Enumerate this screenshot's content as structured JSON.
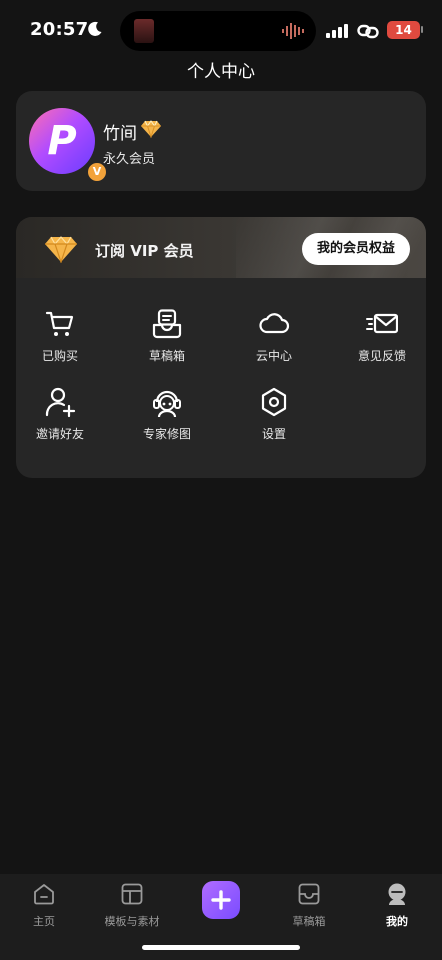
{
  "status_bar": {
    "time": "20:57",
    "battery": "14"
  },
  "header": {
    "title": "个人中心"
  },
  "profile": {
    "avatar_letter": "P",
    "badge_letter": "V",
    "username": "竹间",
    "member_type": "永久会员"
  },
  "vip": {
    "label": "订阅 VIP 会员",
    "button_label": "我的会员权益"
  },
  "menu": {
    "items": [
      {
        "label": "已购买",
        "icon": "cart-icon"
      },
      {
        "label": "草稿箱",
        "icon": "drafts-icon"
      },
      {
        "label": "云中心",
        "icon": "cloud-icon"
      },
      {
        "label": "意见反馈",
        "icon": "feedback-mail-icon"
      },
      {
        "label": "邀请好友",
        "icon": "add-user-icon"
      },
      {
        "label": "专家修图",
        "icon": "expert-icon"
      },
      {
        "label": "设置",
        "icon": "settings-icon"
      }
    ]
  },
  "tabbar": {
    "items": [
      {
        "label": "主页",
        "icon": "home-icon"
      },
      {
        "label": "模板与素材",
        "icon": "template-icon"
      },
      {
        "label": "",
        "icon": "plus-icon"
      },
      {
        "label": "草稿箱",
        "icon": "drafts-tray-icon"
      },
      {
        "label": "我的",
        "icon": "profile-icon"
      }
    ],
    "active": "我的"
  },
  "colors": {
    "background": "#141414",
    "card": "#262626",
    "accent_purple": "#8a55ff",
    "vip_gold": "#f5b54a",
    "battery_low": "#e04a3f"
  }
}
